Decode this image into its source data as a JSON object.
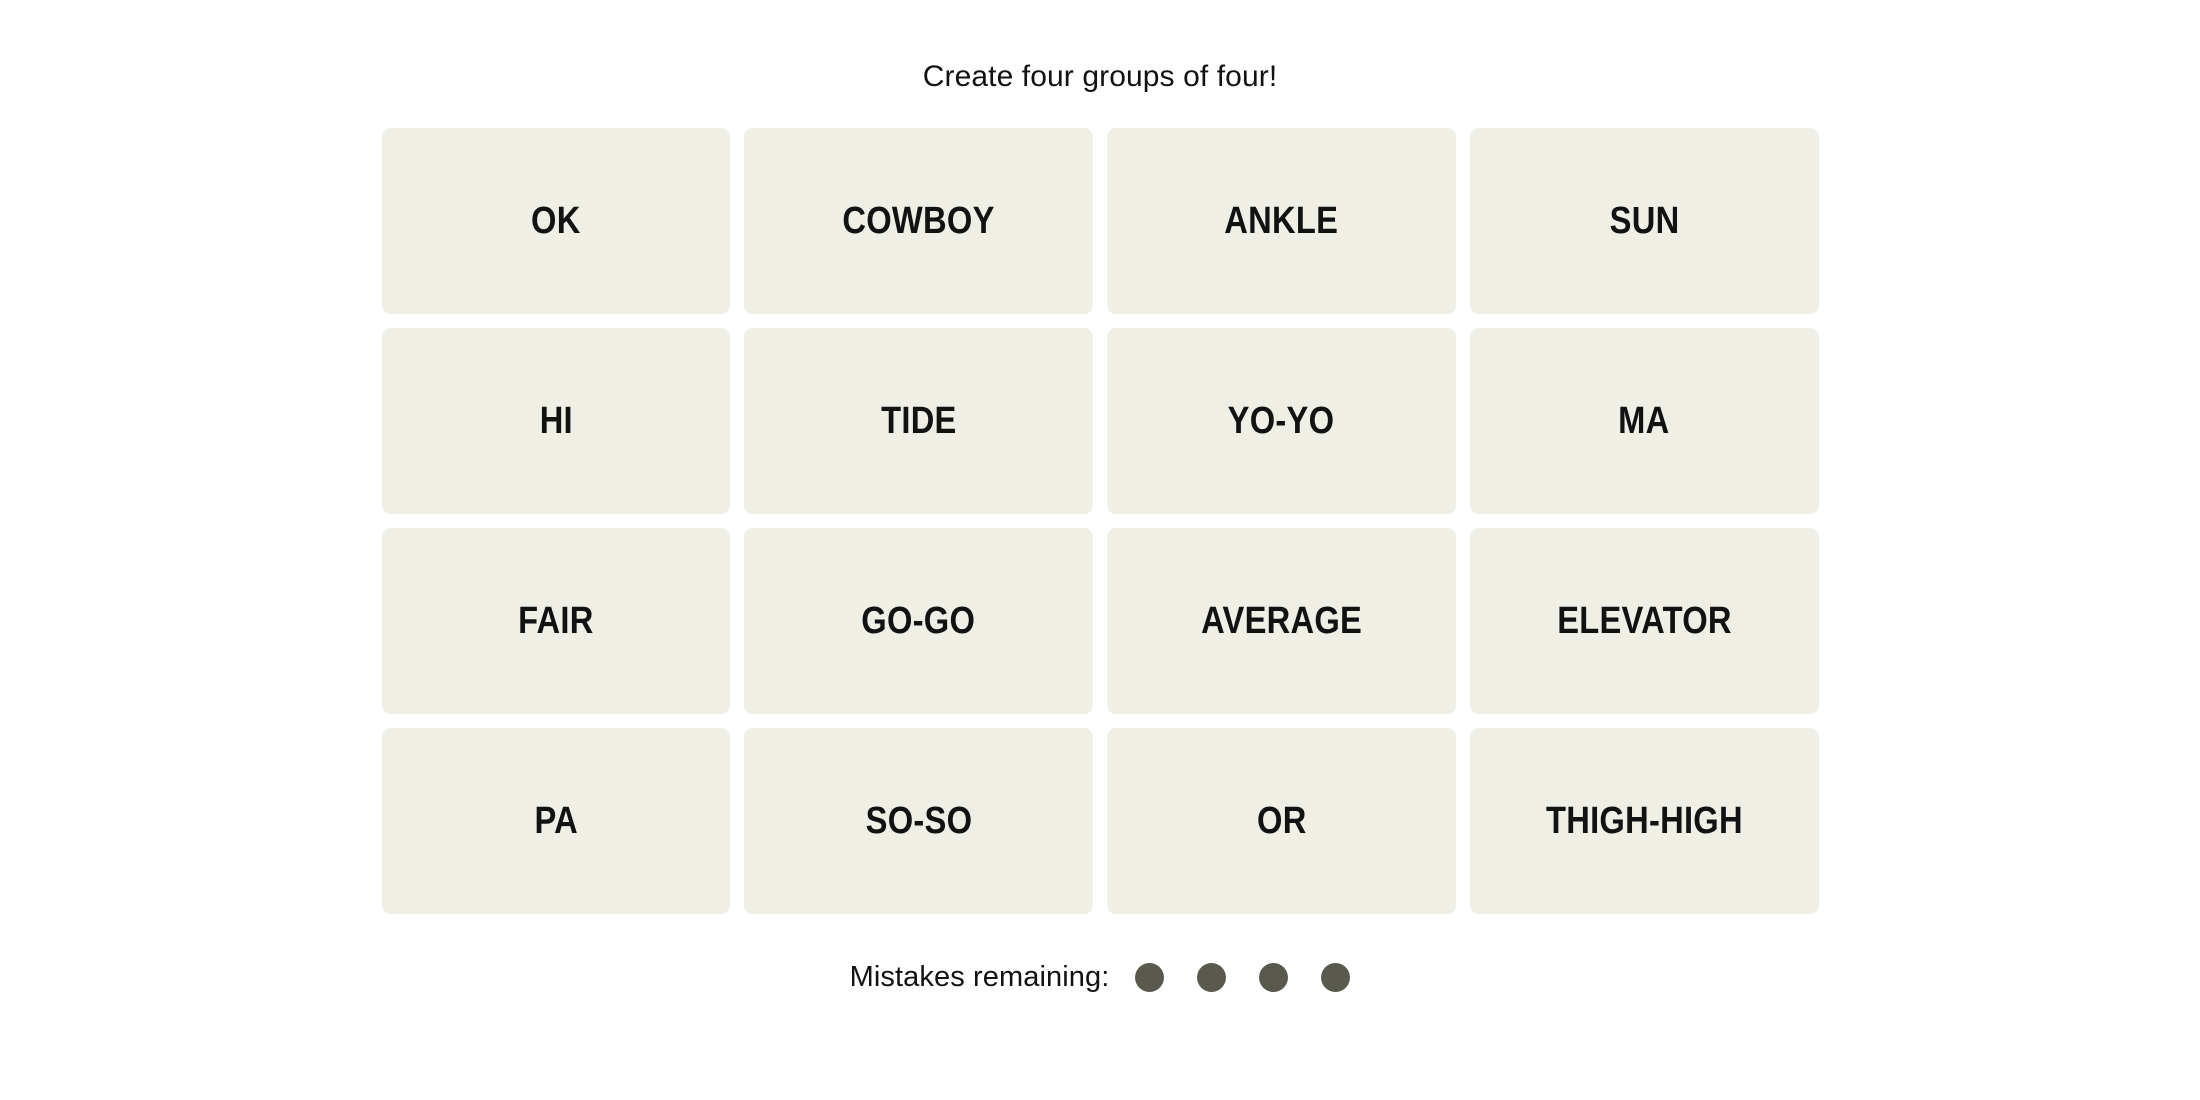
{
  "game": {
    "instruction": "Create four groups of four!",
    "board": {
      "rows": [
        [
          "OK",
          "COWBOY",
          "ANKLE",
          "SUN"
        ],
        [
          "HI",
          "TIDE",
          "YO-YO",
          "MA"
        ],
        [
          "FAIR",
          "GO-GO",
          "AVERAGE",
          "ELEVATOR"
        ],
        [
          "PA",
          "SO-SO",
          "OR",
          "THIGH-HIGH"
        ]
      ]
    },
    "mistakes": {
      "label": "Mistakes remaining:",
      "remaining": 4,
      "dot_color": "#5a594d"
    },
    "colors": {
      "page_background": "#ffffff",
      "tile_background": "#efefe6",
      "text": "#121213"
    }
  }
}
